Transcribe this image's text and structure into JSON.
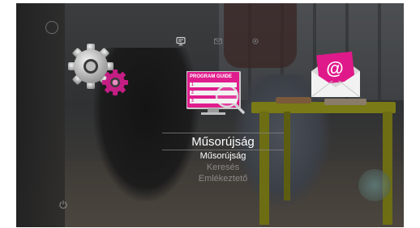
{
  "menu": {
    "title": "Műsorújság",
    "items": [
      {
        "label": "Műsorújság",
        "selected": true
      },
      {
        "label": "Keresés",
        "selected": false
      },
      {
        "label": "Emlékeztető",
        "selected": false
      }
    ]
  },
  "icons": {
    "top": [
      "tv-icon",
      "mail-icon",
      "gear-icon"
    ],
    "main": [
      "settings-gears-icon",
      "program-guide-icon",
      "mail-envelope-icon"
    ]
  },
  "program_guide_icon": {
    "heading": "PROGRAM GUIDE",
    "rows": [
      "1",
      "2",
      "3"
    ]
  },
  "colors": {
    "accent": "#d81c8a",
    "text_active": "#ffffff",
    "text_inactive": "#8a8a8a"
  }
}
